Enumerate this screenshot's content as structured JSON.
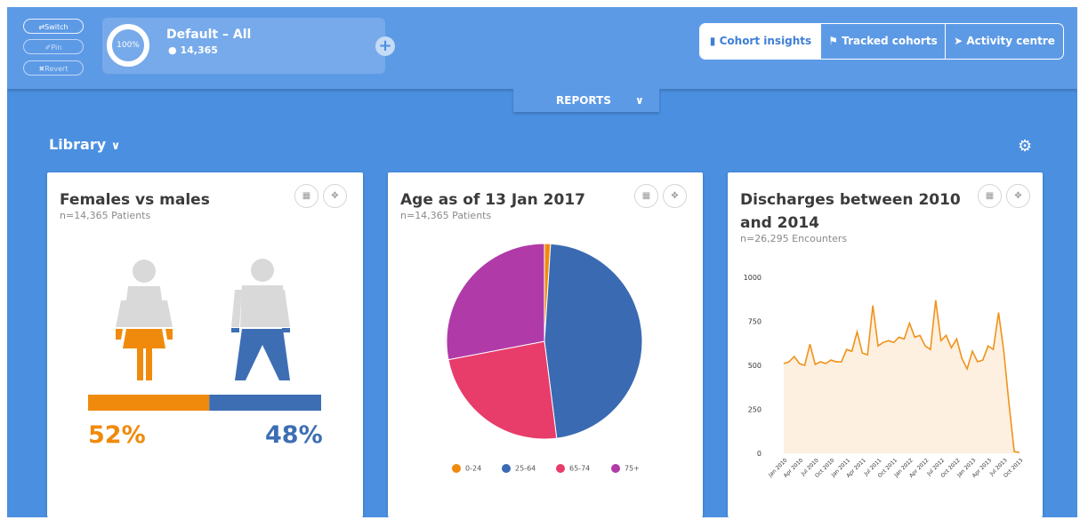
{
  "header": {
    "controls": {
      "switch_label": "⇄Switch",
      "pin_label": "✐Pin",
      "revert_label": "✖Revert"
    },
    "cohort": {
      "percent": "100%",
      "name": "Default – All",
      "count": "14,365"
    },
    "add_label": "+",
    "tabs": [
      {
        "label": "Cohort insights",
        "icon": "bar-chart-icon",
        "active": true
      },
      {
        "label": "Tracked cohorts",
        "icon": "flag-icon",
        "active": false
      },
      {
        "label": "Activity centre",
        "icon": "paper-plane-icon",
        "active": false
      }
    ]
  },
  "reports": {
    "label": "REPORTS"
  },
  "library": {
    "label": "Library"
  },
  "colors": {
    "accent": "#4a8fe0",
    "female": "#f08a0c",
    "male": "#3d6eb4",
    "age_0_24": "#f08a0c",
    "age_25_64": "#3a6ab2",
    "age_65_74": "#e83c6a",
    "age_75_plus": "#b03aa8",
    "line": "#f0921a",
    "area": "#fdf0e0"
  },
  "cards": {
    "gender": {
      "title": "Females vs males",
      "subtitle": "n=14,365 Patients",
      "female_pct_label": "52%",
      "male_pct_label": "48%"
    },
    "age": {
      "title": "Age as of 13 Jan 2017",
      "subtitle": "n=14,365 Patients"
    },
    "discharges": {
      "title_line1": "Discharges between 2010",
      "title_line2": "and 2014",
      "subtitle": "n=26,295 Encounters"
    }
  },
  "chart_data": [
    {
      "type": "bar",
      "categories": [
        "Females",
        "Males"
      ],
      "values": [
        52,
        48
      ],
      "unit": "%"
    },
    {
      "type": "pie",
      "labels": [
        "0-24",
        "25-64",
        "65-74",
        "75+"
      ],
      "values": [
        1,
        47,
        24,
        28
      ]
    },
    {
      "type": "area",
      "ylim": [
        0,
        1000
      ],
      "yticks": [
        0,
        250,
        500,
        750,
        1000
      ],
      "xtick_labels": [
        "Jan 2010",
        "Apr 2010",
        "Jul 2010",
        "Oct 2010",
        "Jan 2011",
        "Apr 2011",
        "Jul 2011",
        "Oct 2011",
        "Jan 2012",
        "Apr 2012",
        "Jul 2012",
        "Oct 2012",
        "Jan 2013",
        "Apr 2013",
        "Jul 2013",
        "Oct 2013"
      ],
      "series": [
        {
          "values": [
            510,
            520,
            550,
            510,
            500,
            620,
            505,
            520,
            510,
            530,
            520,
            520,
            590,
            580,
            690,
            570,
            560,
            840,
            610,
            630,
            640,
            630,
            660,
            650,
            740,
            660,
            670,
            610,
            590,
            870,
            640,
            670,
            600,
            650,
            540,
            480,
            580,
            520,
            530,
            610,
            590,
            800,
            580,
            280,
            10,
            5
          ]
        }
      ]
    }
  ]
}
